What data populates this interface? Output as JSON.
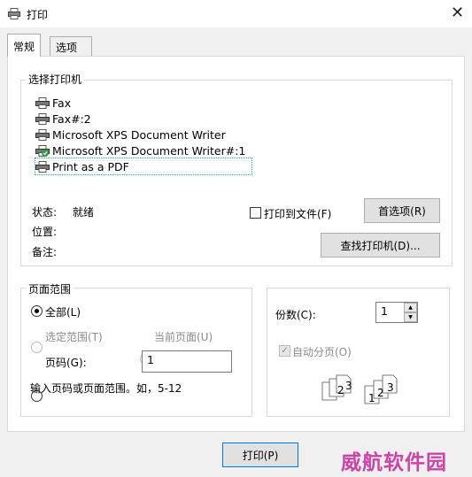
{
  "window": {
    "title": "打印",
    "close_glyph": "✕"
  },
  "tabs": [
    {
      "label": "常规",
      "active": true
    },
    {
      "label": "选项",
      "active": false
    }
  ],
  "printer_group": {
    "label": "选择打印机",
    "printers": [
      {
        "name": "Fax",
        "default": false,
        "selected": false
      },
      {
        "name": "Fax#:2",
        "default": false,
        "selected": false
      },
      {
        "name": "Microsoft XPS Document Writer",
        "default": false,
        "selected": false
      },
      {
        "name": "Microsoft XPS Document Writer#:1",
        "default": true,
        "selected": false
      },
      {
        "name": "Print as a PDF",
        "default": false,
        "selected": true
      }
    ],
    "status_label": "状态:",
    "status_value": "就绪",
    "location_label": "位置:",
    "comment_label": "备注:",
    "print_to_file_label": "打印到文件(F)",
    "print_to_file_checked": false,
    "preferences_button": "首选项(R)",
    "find_printer_button": "查找打印机(D)..."
  },
  "page_range": {
    "label": "页面范围",
    "all_label": "全部(L)",
    "selection_label": "选定范围(T)",
    "current_page_label": "当前页面(U)",
    "pages_label": "页码(G):",
    "pages_value": "1",
    "hint": "输入页码或页面范围。如，5-12",
    "selected": "all"
  },
  "copies": {
    "label": "份数(C):",
    "value": "1",
    "collate_label": "自动分页(O)",
    "collate_checked": true
  },
  "footer": {
    "print_button": "打印(P)"
  },
  "watermark": "威航软件园",
  "colors": {
    "selection_border": "#3399ff",
    "watermark": "#cc44aa"
  }
}
